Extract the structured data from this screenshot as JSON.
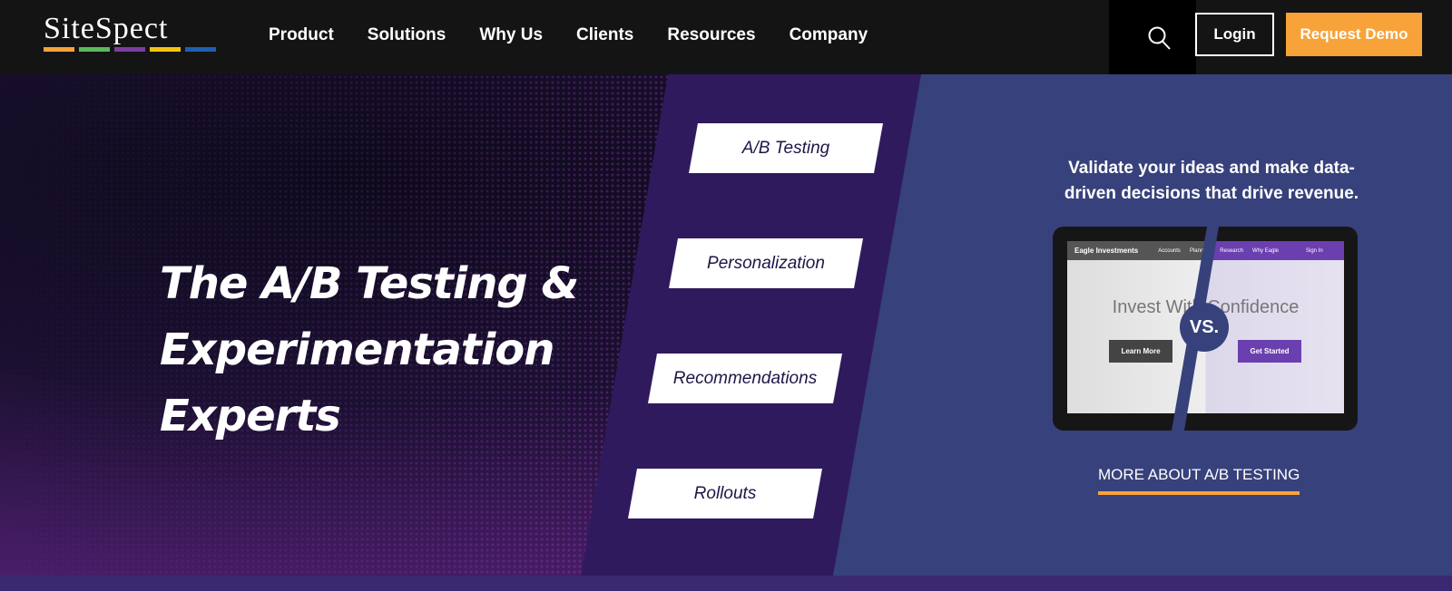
{
  "nav": {
    "logo": "SiteSpect",
    "logo_bar_colors": [
      "#f7a33a",
      "#5cb85c",
      "#7b3fa0",
      "#f2c40f",
      "#1f5fb0"
    ],
    "menu": [
      "Product",
      "Solutions",
      "Why Us",
      "Clients",
      "Resources",
      "Company"
    ],
    "login": "Login",
    "request_demo": "Request Demo",
    "accent": "#f7a33a"
  },
  "hero": {
    "title_lines": [
      "The A/B Testing &",
      "Experimentation",
      "Experts"
    ],
    "pills": [
      "A/B Testing",
      "Personalization",
      "Recommendations",
      "Rollouts"
    ],
    "tagline": "Validate your ideas and make data-driven decisions that drive revenue.",
    "mock": {
      "brand": "Eagle Investments",
      "links": [
        "Accounts",
        "Planning",
        "Research",
        "Why Eagle"
      ],
      "sign_in": "Sign In",
      "headline": "Invest With Confidence",
      "btn_a": "Learn More",
      "btn_b": "Get Started",
      "vs": "VS."
    },
    "more_link": "MORE ABOUT A/B TESTING"
  }
}
